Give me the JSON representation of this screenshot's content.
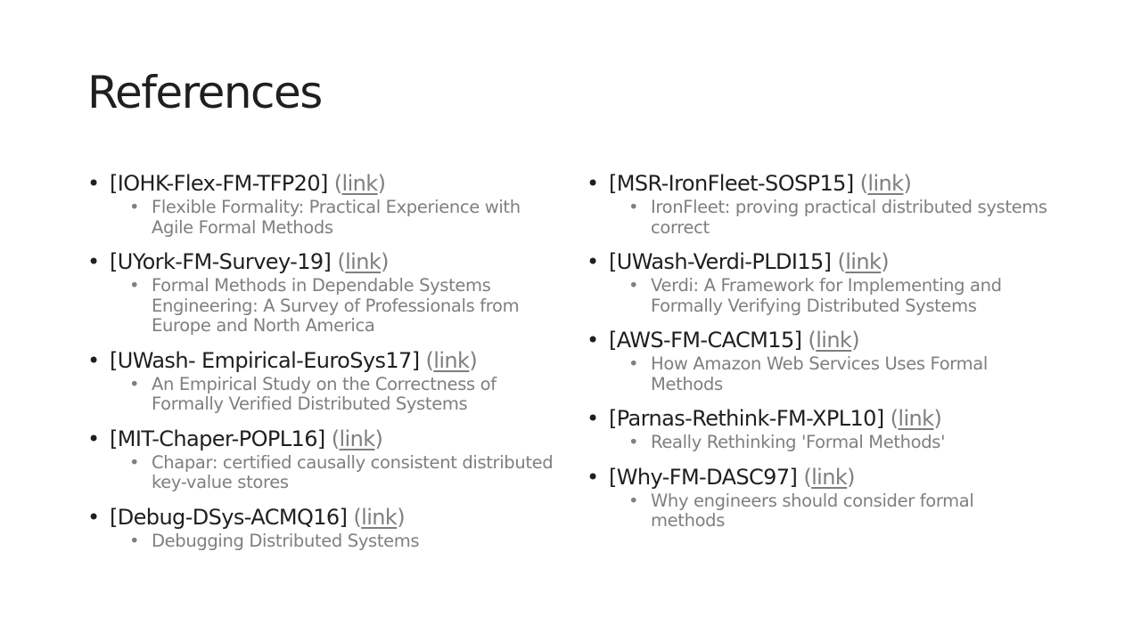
{
  "title": "References",
  "link_label": "link",
  "left": [
    {
      "key": "[IOHK-Flex-FM-TFP20]",
      "desc": "Flexible Formality: Practical Experience with Agile Formal Methods"
    },
    {
      "key": "[UYork-FM-Survey-19]",
      "desc": "Formal Methods in Dependable Systems Engineering: A Survey of Professionals from Europe and North America"
    },
    {
      "key": "[UWash- Empirical-EuroSys17]",
      "desc": "An Empirical Study on the Correctness of Formally Verified Distributed Systems"
    },
    {
      "key": "[MIT-Chaper-POPL16]",
      "desc": "Chapar: certified causally consistent distributed key-value stores"
    },
    {
      "key": "[Debug-DSys-ACMQ16]",
      "desc": "Debugging Distributed Systems"
    }
  ],
  "right": [
    {
      "key": "[MSR-IronFleet-SOSP15]",
      "desc": "IronFleet: proving practical distributed systems correct"
    },
    {
      "key": "[UWash-Verdi-PLDI15]",
      "desc": "Verdi: A Framework for Implementing and Formally Verifying Distributed Systems"
    },
    {
      "key": "[AWS-FM-CACM15]",
      "desc": "How Amazon Web Services Uses Formal Methods"
    },
    {
      "key": "[Parnas-Rethink-FM-XPL10]",
      "desc": "Really Rethinking 'Formal Methods'"
    },
    {
      "key": "[Why-FM-DASC97]",
      "desc": "Why engineers should consider formal methods"
    }
  ]
}
